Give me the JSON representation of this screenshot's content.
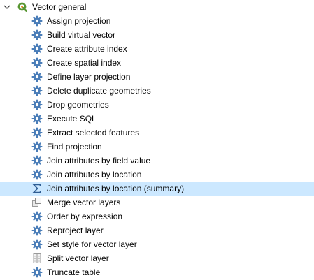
{
  "tree": {
    "group": {
      "label": "Vector general",
      "expanded": true,
      "icon": "qgis-icon"
    },
    "items": [
      {
        "label": "Assign projection",
        "icon": "gear-icon"
      },
      {
        "label": "Build virtual vector",
        "icon": "gear-icon"
      },
      {
        "label": "Create attribute index",
        "icon": "gear-icon"
      },
      {
        "label": "Create spatial index",
        "icon": "gear-icon"
      },
      {
        "label": "Define layer projection",
        "icon": "gear-icon"
      },
      {
        "label": "Delete duplicate geometries",
        "icon": "gear-icon"
      },
      {
        "label": "Drop geometries",
        "icon": "gear-icon"
      },
      {
        "label": "Execute SQL",
        "icon": "gear-icon"
      },
      {
        "label": "Extract selected features",
        "icon": "gear-icon"
      },
      {
        "label": "Find projection",
        "icon": "gear-icon"
      },
      {
        "label": "Join attributes by field value",
        "icon": "gear-icon"
      },
      {
        "label": "Join attributes by location",
        "icon": "gear-icon"
      },
      {
        "label": "Join attributes by location (summary)",
        "icon": "sigma-icon",
        "selected": true
      },
      {
        "label": "Merge vector layers",
        "icon": "merge-layers-icon"
      },
      {
        "label": "Order by expression",
        "icon": "gear-icon"
      },
      {
        "label": "Reproject layer",
        "icon": "gear-icon"
      },
      {
        "label": "Set style for vector layer",
        "icon": "gear-icon"
      },
      {
        "label": "Split vector layer",
        "icon": "split-layer-icon"
      },
      {
        "label": "Truncate table",
        "icon": "gear-icon"
      }
    ]
  },
  "colors": {
    "selection": "#cce8ff",
    "gear": "#4a7db8",
    "qgis_green": "#589632",
    "qgis_yellow": "#ee7913"
  }
}
